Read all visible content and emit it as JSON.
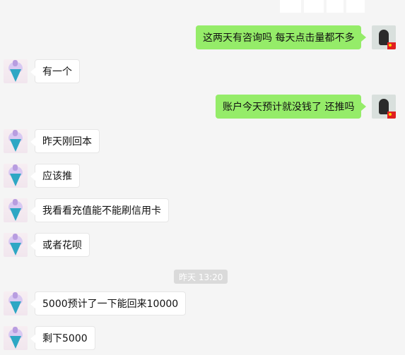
{
  "messages": [
    {
      "side": "right",
      "text": "这两天有咨询吗 每天点击量都不多"
    },
    {
      "side": "left",
      "text": "有一个"
    },
    {
      "side": "right",
      "text": "账户今天预计就没钱了 还推吗"
    },
    {
      "side": "left",
      "text": "昨天刚回本"
    },
    {
      "side": "left",
      "text": "应该推"
    },
    {
      "side": "left",
      "text": "我看看充值能不能刷信用卡"
    },
    {
      "side": "left",
      "text": "或者花呗"
    },
    {
      "side": "left",
      "text": "5000预计了一下能回来10000"
    },
    {
      "side": "left",
      "text": "剩下5000"
    }
  ],
  "timestamp": "昨天 13:20",
  "colors": {
    "background": "#f5f5f5",
    "self_bubble": "#95ec69",
    "other_bubble": "#ffffff",
    "timestamp_bg": "#dadada"
  },
  "icons": {
    "other_avatar": "ice-cream-avatar",
    "self_avatar": "person-avatar"
  }
}
